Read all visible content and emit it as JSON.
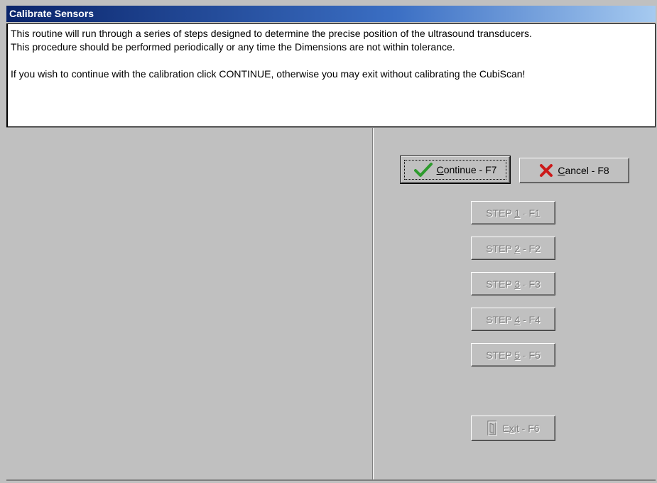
{
  "window": {
    "title": "Calibrate Sensors"
  },
  "message": {
    "line1": "This routine will run through a series of steps designed to determine the precise position of the ultrasound transducers.",
    "line2": "This procedure should be performed periodically or any time the Dimensions are not within tolerance.",
    "line3": "If you wish to continue with the calibration click CONTINUE, otherwise you may exit without calibrating the CubiScan!"
  },
  "buttons": {
    "continue": {
      "pre": "",
      "hot": "C",
      "post": "ontinue - F7",
      "icon": "checkmark-icon",
      "color": "#2e9b2e"
    },
    "cancel": {
      "pre": "",
      "hot": "C",
      "post": "ancel - F8",
      "icon": "x-icon",
      "color": "#cc1a1a"
    },
    "step1": {
      "pre": "STEP ",
      "hot": "1",
      "post": " - F1"
    },
    "step2": {
      "pre": "STEP ",
      "hot": "2",
      "post": " - F2"
    },
    "step3": {
      "pre": "STEP ",
      "hot": "3",
      "post": " - F3"
    },
    "step4": {
      "pre": "STEP ",
      "hot": "4",
      "post": " - F4"
    },
    "step5": {
      "pre": "STEP ",
      "hot": "5",
      "post": " - F5"
    },
    "exit": {
      "pre": "E",
      "hot": "x",
      "post": "it - F6",
      "icon": "door-icon"
    }
  }
}
